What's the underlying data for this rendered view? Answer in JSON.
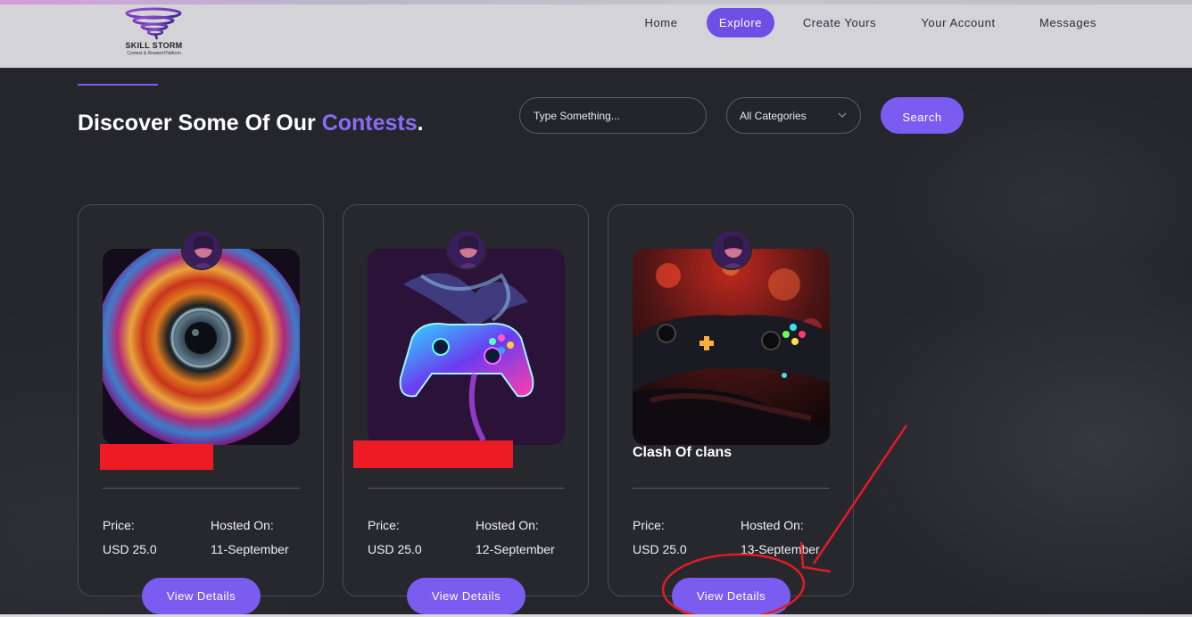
{
  "header": {
    "logo_title": "SKILL STORM",
    "logo_subtitle": "Contest & Reward Platform",
    "nav": [
      {
        "label": "Home",
        "active": false
      },
      {
        "label": "Explore",
        "active": true
      },
      {
        "label": "Create Yours",
        "active": false
      },
      {
        "label": "Your Account",
        "active": false
      },
      {
        "label": "Messages",
        "active": false
      }
    ]
  },
  "main": {
    "title_prefix": "Discover Some Of Our ",
    "title_accent": "Contests",
    "title_suffix": ".",
    "search": {
      "placeholder": "Type Something..."
    },
    "category": {
      "selected": "All Categories",
      "icon": "chevron-down-icon"
    },
    "search_button": "Search"
  },
  "cards": [
    {
      "name": "",
      "name_redacted": true,
      "price_label": "Price:",
      "price": "USD 25.0",
      "hosted_label": "Hosted On:",
      "hosted": "11-September",
      "button": "View Details",
      "image": "camera-lens-art"
    },
    {
      "name": "",
      "name_redacted": true,
      "price_label": "Price:",
      "price": "USD 25.0",
      "hosted_label": "Hosted On:",
      "hosted": "12-September",
      "button": "View Details",
      "image": "neon-gamepad-art"
    },
    {
      "name": "Clash Of clans",
      "name_redacted": false,
      "price_label": "Price:",
      "price": "USD 25.0",
      "hosted_label": "Hosted On:",
      "hosted": "13-September",
      "button": "View Details",
      "image": "game-controller-photo"
    }
  ],
  "colors": {
    "accent": "#7b5cf0",
    "background": "#25252c",
    "header": "#d4d4d8",
    "redaction": "#ed1c24",
    "annotation": "#e21b23"
  }
}
